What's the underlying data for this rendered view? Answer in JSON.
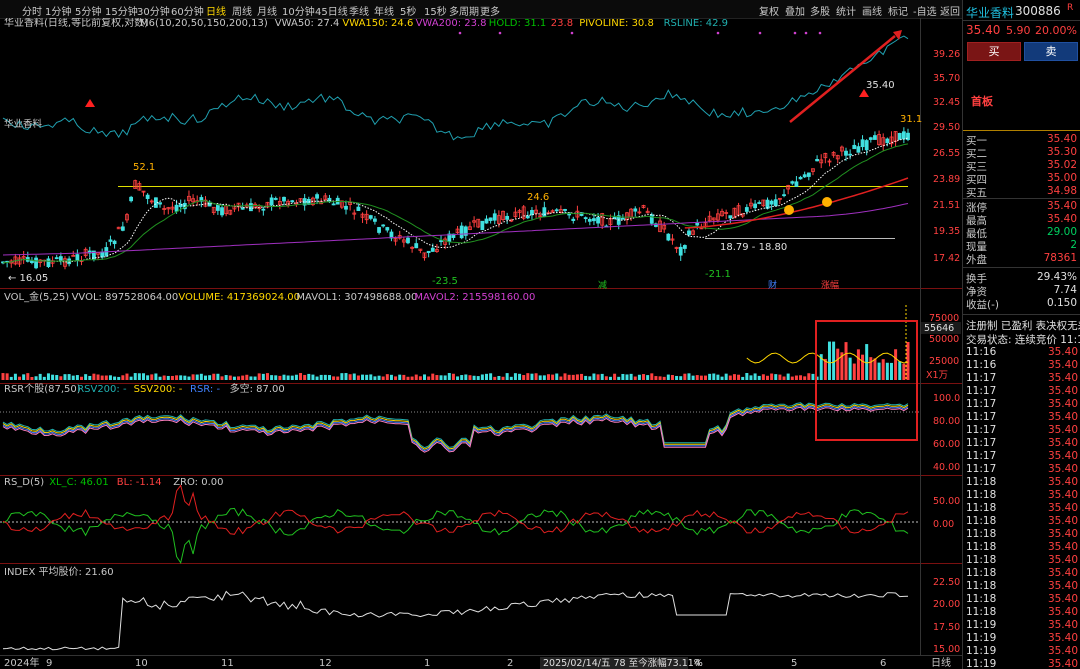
{
  "toolbar": {
    "timeframes": [
      "分时",
      "1分钟",
      "5分钟",
      "15分钟",
      "30分钟",
      "60分钟",
      "日线",
      "周线",
      "月线",
      "10分钟",
      "45日线",
      "季线",
      "年线",
      "5秒",
      "15秒",
      "多周期",
      "更多"
    ],
    "active_index": 6,
    "tools": [
      "复权",
      "叠加",
      "多股",
      "统计",
      "画线",
      "标记",
      "-自选",
      "返回"
    ]
  },
  "main_panel": {
    "title": "华业香料(日线,等比前复权,对数)",
    "indicators": [
      {
        "text": "M6(10,20,50,150,200,13)",
        "color": "#c8c8c8"
      },
      {
        "text": "VWA50: 27.4",
        "color": "#c8c8c8"
      },
      {
        "text": "VWA150: 24.6",
        "color": "#ffd700"
      },
      {
        "text": "VWA200: 23.8",
        "color": "#d040d0"
      },
      {
        "text": "HOLD: 31.1",
        "color": "#00c000"
      },
      {
        "text": "23.8",
        "color": "#ff4040"
      },
      {
        "text": "PIVOLINE: 30.8",
        "color": "#ffd700"
      },
      {
        "text": "RSLINE: 42.9",
        "color": "#20b0b0"
      }
    ],
    "side_label": "华业香料",
    "y_labels": [
      "39.26",
      "35.70",
      "32.45",
      "29.50",
      "26.55",
      "23.89",
      "21.51",
      "19.35",
      "17.42"
    ],
    "annotations": [
      "52.1",
      "24.6",
      "-23.5",
      "-21.1",
      "18.79 - 18.80",
      "35.40",
      "31.1",
      "← 16.05"
    ],
    "event_markers": [
      {
        "text": "减",
        "color": "#20c020"
      },
      {
        "text": "财",
        "color": "#4080ff"
      },
      {
        "text": "涨幅",
        "color": "#ff4040"
      }
    ]
  },
  "vol_panel": {
    "indicators": [
      {
        "text": "VOL_金(5,25)",
        "color": "#c8c8c8"
      },
      {
        "text": "VVOL: 897528064.00",
        "color": "#c8c8c8"
      },
      {
        "text": "VOLUME: 417369024.00",
        "color": "#ffd700"
      },
      {
        "text": "MAVOL1: 307498688.00",
        "color": "#c8c8c8"
      },
      {
        "text": "MAVOL2: 215598160.00",
        "color": "#d040d0"
      }
    ],
    "y_labels": [
      "75000",
      "50000",
      "25000"
    ],
    "current": "55646",
    "unit": "X1万"
  },
  "rsr_panel": {
    "indicators": [
      {
        "text": "RSR个股(87,50)",
        "color": "#c8c8c8"
      },
      {
        "text": "RSV200: -",
        "color": "#20b0b0"
      },
      {
        "text": "SSV200: -",
        "color": "#ffd700"
      },
      {
        "text": "RSR: -",
        "color": "#4080ff"
      },
      {
        "text": "多空: 87.00",
        "color": "#c8c8c8"
      }
    ],
    "y_labels": [
      "100.0",
      "80.00",
      "60.00",
      "40.00"
    ]
  },
  "rsd_panel": {
    "indicators": [
      {
        "text": "RS_D(5)",
        "color": "#c8c8c8"
      },
      {
        "text": "XL_C: 46.01",
        "color": "#00c000"
      },
      {
        "text": "BL: -1.14",
        "color": "#ff4040"
      },
      {
        "text": "ZRO: 0.00",
        "color": "#c8c8c8"
      }
    ],
    "y_labels": [
      "50.00",
      "0.00"
    ]
  },
  "index_panel": {
    "indicators": [
      {
        "text": "INDEX 平均股价: 21.60",
        "color": "#c8c8c8"
      }
    ],
    "y_labels": [
      "22.50",
      "20.00",
      "17.50",
      "15.00"
    ]
  },
  "x_axis": {
    "labels": [
      "2024年",
      "9",
      "10",
      "11",
      "12",
      "1",
      "2",
      "4",
      "5",
      "6"
    ],
    "period_label": "日线",
    "status": "2025/02/14/五 78 至今涨幅73.11%"
  },
  "right_panel": {
    "stock_name": "华业香料",
    "code": "300886",
    "code_flag": "R",
    "price": "35.40",
    "change": "5.90",
    "change_pct": "20.00%",
    "buy_label": "买",
    "sell_label": "卖",
    "board": "首板",
    "board_info": [
      "当前封单",
      "封单占成",
      "封单占流",
      "十日总涨"
    ],
    "order_book": [
      {
        "label": "买一",
        "value": "35.40"
      },
      {
        "label": "买二",
        "value": "35.30"
      },
      {
        "label": "买三",
        "value": "35.02"
      },
      {
        "label": "买四",
        "value": "35.00"
      },
      {
        "label": "买五",
        "value": "34.98"
      }
    ],
    "stats": [
      {
        "label": "涨停",
        "value": "35.40",
        "cls": "r"
      },
      {
        "label": "最高",
        "value": "35.40",
        "cls": "r"
      },
      {
        "label": "最低",
        "value": "29.00",
        "cls": "g"
      },
      {
        "label": "现量",
        "value": "2",
        "cls": "g"
      },
      {
        "label": "外盘",
        "value": "78361",
        "cls": "r"
      }
    ],
    "stats2": [
      {
        "label": "换手",
        "value": "29.43%"
      },
      {
        "label": "净资",
        "value": "7.74"
      },
      {
        "label": "收益(-)",
        "value": "0.150"
      }
    ],
    "notice1": "注册制 已盈利 表决权无差",
    "notice2": "交易状态: 连续竞价 11:19",
    "ticks": [
      {
        "time": "11:16",
        "price": "35.40"
      },
      {
        "time": "11:16",
        "price": "35.40"
      },
      {
        "time": "11:17",
        "price": "35.40"
      },
      {
        "time": "11:17",
        "price": "35.40"
      },
      {
        "time": "11:17",
        "price": "35.40"
      },
      {
        "time": "11:17",
        "price": "35.40"
      },
      {
        "time": "11:17",
        "price": "35.40"
      },
      {
        "time": "11:17",
        "price": "35.40"
      },
      {
        "time": "11:17",
        "price": "35.40"
      },
      {
        "time": "11:17",
        "price": "35.40"
      },
      {
        "time": "11:18",
        "price": "35.40"
      },
      {
        "time": "11:18",
        "price": "35.40"
      },
      {
        "time": "11:18",
        "price": "35.40"
      },
      {
        "time": "11:18",
        "price": "35.40"
      },
      {
        "time": "11:18",
        "price": "35.40"
      },
      {
        "time": "11:18",
        "price": "35.40"
      },
      {
        "time": "11:18",
        "price": "35.40"
      },
      {
        "time": "11:18",
        "price": "35.40"
      },
      {
        "time": "11:18",
        "price": "35.40"
      },
      {
        "time": "11:18",
        "price": "35.40"
      },
      {
        "time": "11:18",
        "price": "35.40"
      },
      {
        "time": "11:19",
        "price": "35.40"
      },
      {
        "time": "11:19",
        "price": "35.40"
      },
      {
        "time": "11:19",
        "price": "35.40"
      },
      {
        "time": "11:19",
        "price": "35.40"
      }
    ]
  }
}
